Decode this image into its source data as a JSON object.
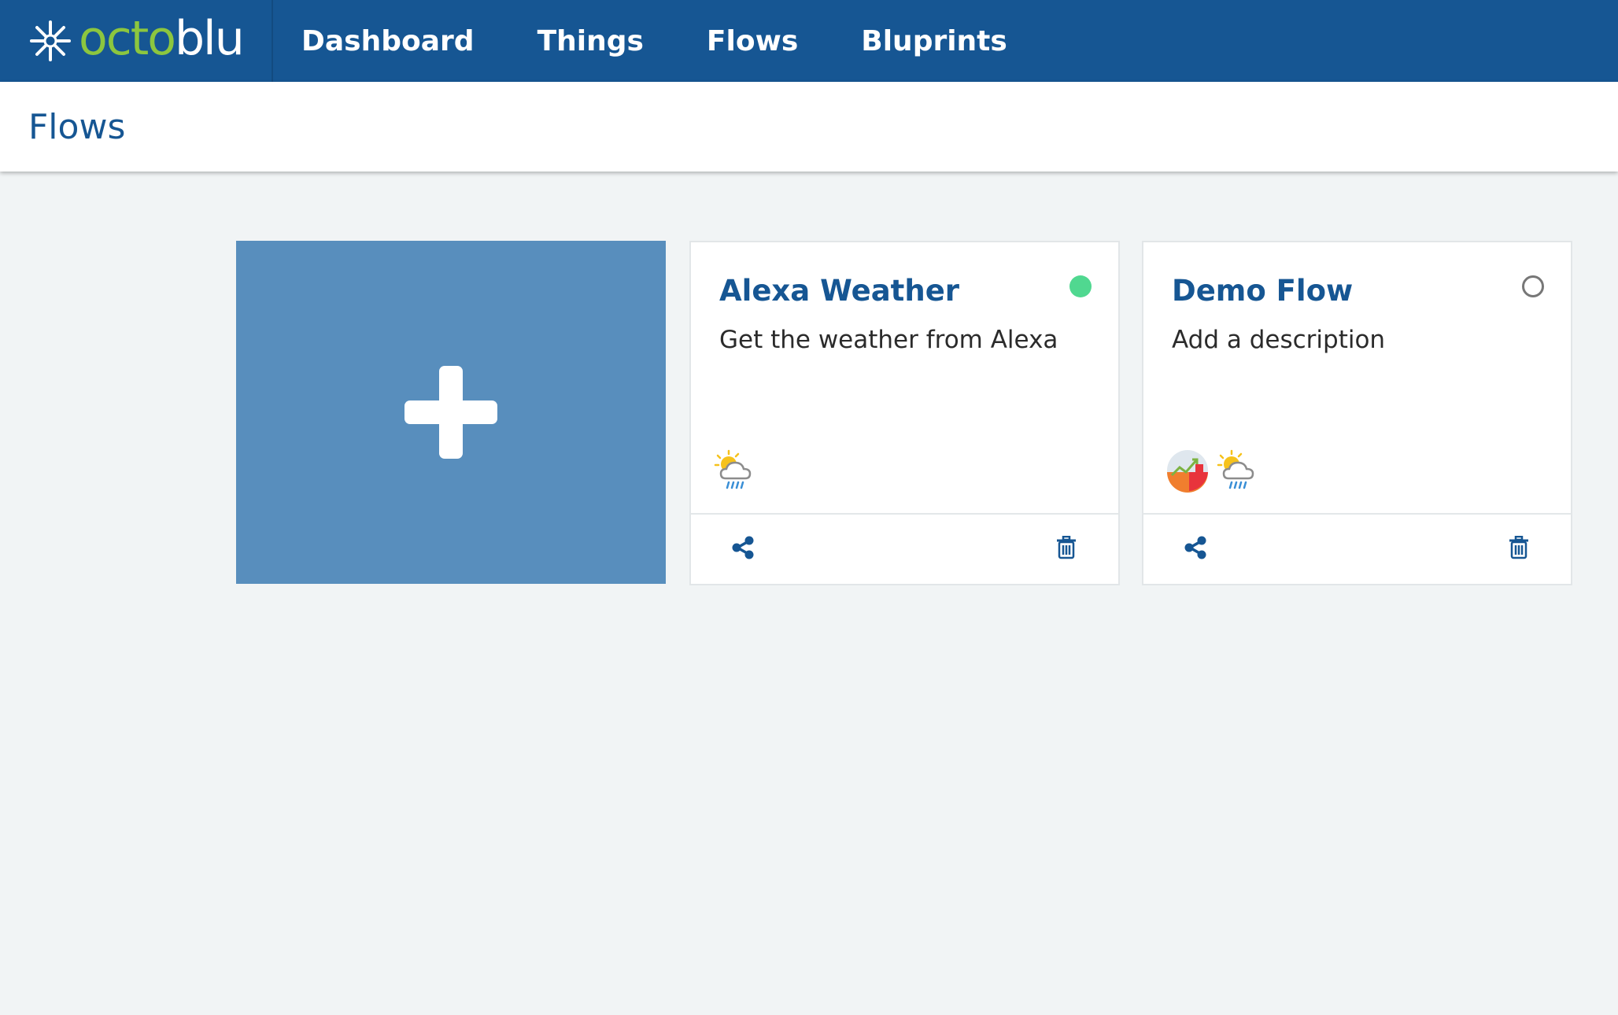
{
  "brand": {
    "logo_octo": "octo",
    "logo_blu": "blu",
    "logo_icon": "octoblu-star-icon",
    "color_green": "#8cc63f"
  },
  "nav": {
    "items": [
      {
        "label": "Dashboard"
      },
      {
        "label": "Things"
      },
      {
        "label": "Flows"
      },
      {
        "label": "Bluprints"
      }
    ]
  },
  "header": {
    "title": "Flows"
  },
  "new_flow": {
    "icon": "plus-icon"
  },
  "flows": [
    {
      "name": "Alexa Weather",
      "description": "Get the weather from Alexa",
      "status": "online",
      "status_color": "#50d890",
      "node_icons": [
        "weather-icon"
      ],
      "actions": [
        "share-icon",
        "trash-icon"
      ]
    },
    {
      "name": "Demo Flow",
      "description": "Add a description",
      "status": "offline",
      "status_color": "#777777",
      "node_icons": [
        "chart-icon",
        "weather-icon"
      ],
      "actions": [
        "share-icon",
        "trash-icon"
      ]
    }
  ],
  "colors": {
    "nav_bg": "#165693",
    "accent": "#165693",
    "new_card_bg": "#588ebd",
    "page_bg": "#f1f4f5"
  }
}
